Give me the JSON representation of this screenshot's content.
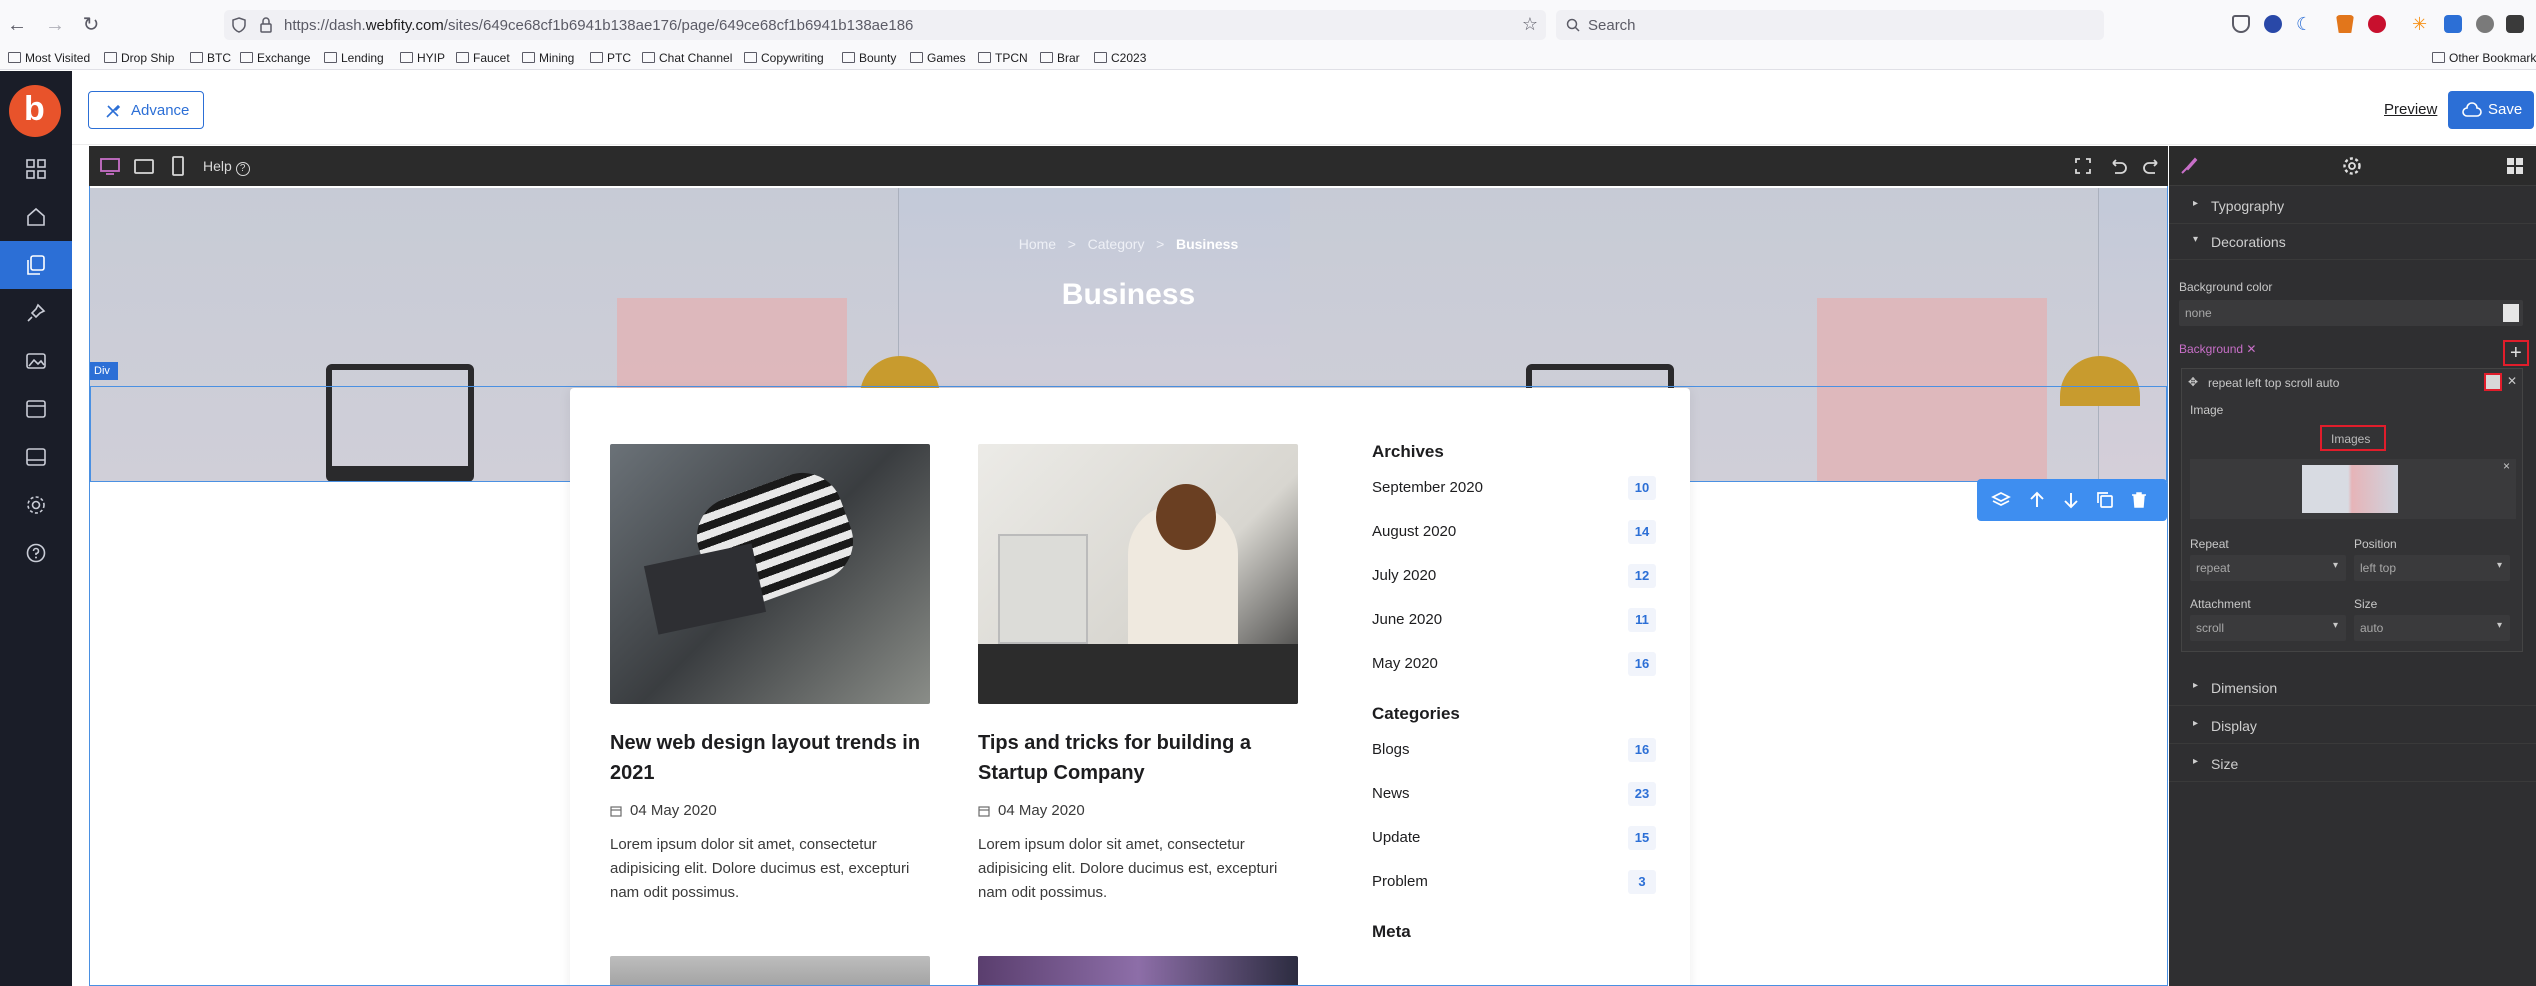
{
  "browser": {
    "url_prefix": "https://dash.",
    "url_domain": "webfity.com",
    "url_path": "/sites/649ce68cf1b6941b138ae176/page/649ce68cf1b6941b138ae186",
    "search_placeholder": "Search"
  },
  "bookmarks": {
    "items": [
      "Most Visited",
      "Drop Ship",
      "BTC",
      "Exchange",
      "Lending",
      "HYIP",
      "Faucet",
      "Mining",
      "PTC",
      "Chat Channel",
      "Copywriting",
      "Bounty",
      "Games",
      "TPCN",
      "Brar",
      "C2023"
    ],
    "other": "Other Bookmarks"
  },
  "header": {
    "advance_label": "Advance",
    "preview_label": "Preview",
    "save_label": "Save"
  },
  "toolbar": {
    "help_label": "Help"
  },
  "hero": {
    "breadcrumb_home": "Home",
    "breadcrumb_sep": ">",
    "breadcrumb_category": "Category",
    "breadcrumb_current": "Business",
    "title": "Business",
    "div_tag": "Div"
  },
  "posts": [
    {
      "title": "New web design layout trends in 2021",
      "date": "04 May 2020",
      "excerpt": "Lorem ipsum dolor sit amet, consectetur adipisicing elit. Dolore ducimus est, excepturi nam odit possimus."
    },
    {
      "title": "Tips and tricks for building a Startup Company",
      "date": "04 May 2020",
      "excerpt": "Lorem ipsum dolor sit amet, consectetur adipisicing elit. Dolore ducimus est, excepturi nam odit possimus."
    }
  ],
  "widgets": {
    "archives_title": "Archives",
    "archives": [
      {
        "name": "September 2020",
        "count": "10"
      },
      {
        "name": "August 2020",
        "count": "14"
      },
      {
        "name": "July 2020",
        "count": "12"
      },
      {
        "name": "June 2020",
        "count": "11"
      },
      {
        "name": "May 2020",
        "count": "16"
      }
    ],
    "categories_title": "Categories",
    "categories": [
      {
        "name": "Blogs",
        "count": "16"
      },
      {
        "name": "News",
        "count": "23"
      },
      {
        "name": "Update",
        "count": "15"
      },
      {
        "name": "Problem",
        "count": "3"
      }
    ],
    "meta_title": "Meta"
  },
  "panel": {
    "typography": "Typography",
    "decorations": "Decorations",
    "bg_color_label": "Background color",
    "bg_color_value": "none",
    "background_label": "Background",
    "layer_summary": "repeat left top scroll auto",
    "image_label": "Image",
    "images_button": "Images",
    "repeat_label": "Repeat",
    "repeat_value": "repeat",
    "position_label": "Position",
    "position_value": "left top",
    "attachment_label": "Attachment",
    "attachment_value": "scroll",
    "size_label": "Size",
    "size_value": "auto",
    "dimension": "Dimension",
    "display": "Display",
    "size_section": "Size"
  },
  "colors": {
    "accent": "#2c6fd6",
    "sidebar_bg": "#1a1d28",
    "panel_bg": "#2f2f31",
    "highlight": "#e11d2b",
    "background_pink": "#c86fc8"
  }
}
